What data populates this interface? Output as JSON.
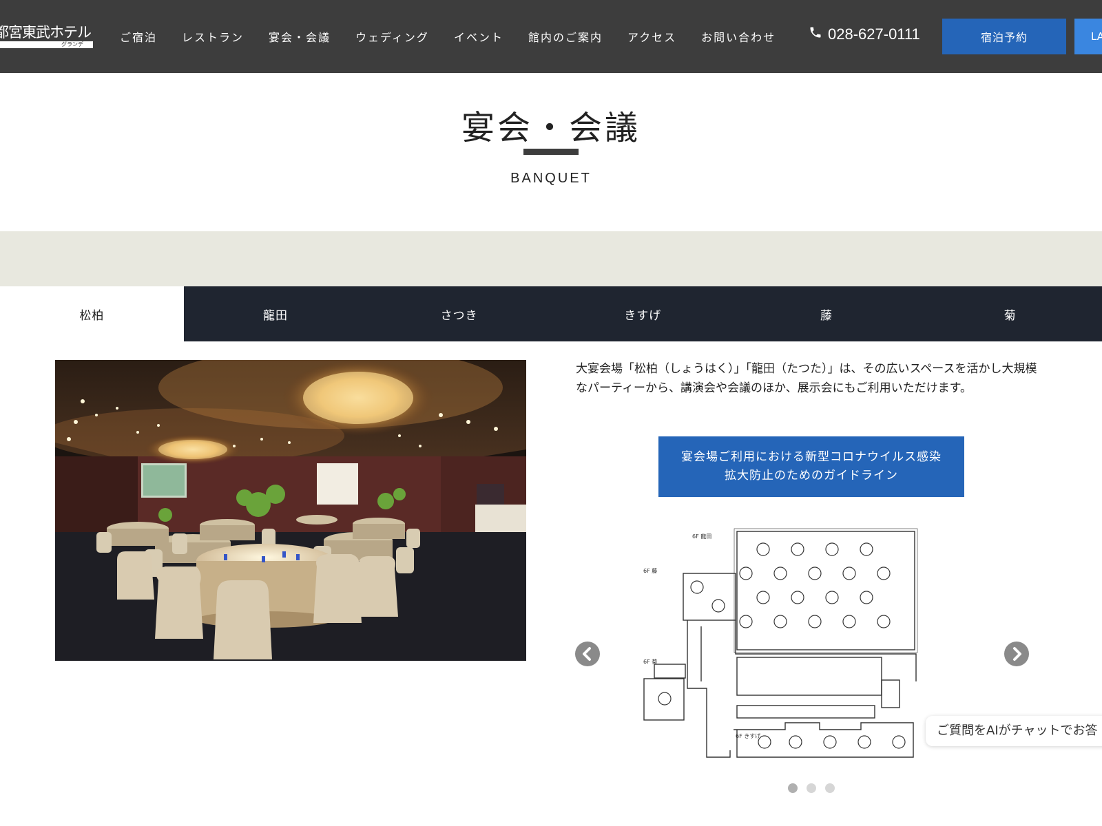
{
  "header": {
    "logo_text": "都宮東武ホテル",
    "logo_sub": "グランデ",
    "nav": [
      "ご宿泊",
      "レストラン",
      "宴会・会議",
      "ウェディング",
      "イベント",
      "館内のご案内",
      "アクセス",
      "お問い合わせ"
    ],
    "phone": "028-627-0111",
    "reserve_label": "宿泊予約",
    "lang_label": "LA"
  },
  "title": {
    "main": "宴会・会議",
    "sub": "BANQUET"
  },
  "tabs": [
    {
      "label": "松柏",
      "active": true
    },
    {
      "label": "龍田",
      "active": false
    },
    {
      "label": "さつき",
      "active": false
    },
    {
      "label": "きすげ",
      "active": false
    },
    {
      "label": "藤",
      "active": false
    },
    {
      "label": "菊",
      "active": false
    }
  ],
  "content": {
    "description": "大宴会場「松柏（しょうはく）」「龍田（たつた）」は、その広いスペースを活かし大規模なパーティーから、講演会や会議のほか、展示会にもご利用いただけます。",
    "guide_line1": "宴会場ご利用における新型コロナウイルス感染",
    "guide_line2": "拡大防止のためのガイドライン"
  },
  "floorplan": {
    "label_tatsuta": "6F 龍田",
    "label_fuji": "6F 藤",
    "label_kiku": "6F 菊",
    "label_kisuge": "6F きすげ"
  },
  "carousel": {
    "slide_count": 3,
    "active_index": 0
  },
  "chat": {
    "text": "ご質問をAIがチャットでお答"
  },
  "colors": {
    "header_bg": "#3d3d3d",
    "accent_blue": "#2565b8",
    "tab_bar": "#1f2530",
    "band": "#e8e8df"
  }
}
